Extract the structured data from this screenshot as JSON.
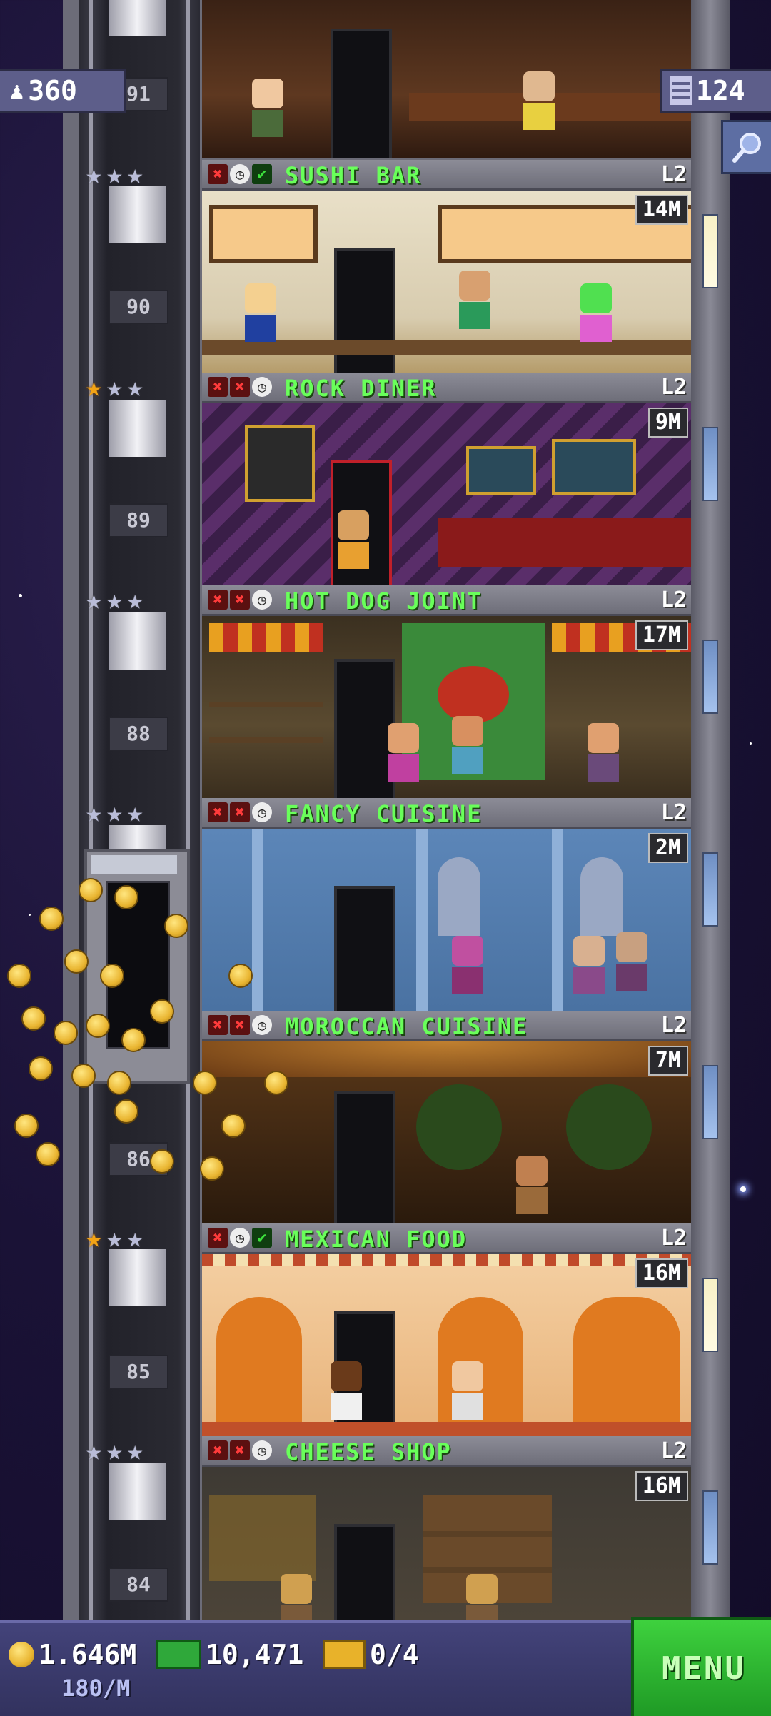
{
  "hud": {
    "population": "360",
    "floors_count": "124",
    "coins": "1.646M",
    "coin_rate": "180/M",
    "bux": "10,471",
    "tickets": "0/4",
    "menu_label": "MENU"
  },
  "icons": {
    "population": "person-icon",
    "floors": "building-icon",
    "search": "magnifier-icon",
    "coins": "coin-icon",
    "bux": "banknote-icon",
    "tickets": "ticket-icon"
  },
  "elevator": {
    "floor_numbers": [
      "91",
      "90",
      "89",
      "88",
      "86",
      "85",
      "84"
    ]
  },
  "floors": [
    {
      "name": "SUSHI BAR",
      "level": "L2",
      "badge": "14M",
      "stars_gold": 0,
      "status": [
        "x",
        "clock",
        "check"
      ]
    },
    {
      "name": "ROCK DINER",
      "level": "L2",
      "badge": "9M",
      "stars_gold": 1,
      "status": [
        "x",
        "x",
        "clock"
      ]
    },
    {
      "name": "HOT DOG JOINT",
      "level": "L2",
      "badge": "17M",
      "stars_gold": 0,
      "status": [
        "x",
        "x",
        "clock"
      ]
    },
    {
      "name": "FANCY CUISINE",
      "level": "L2",
      "badge": "2M",
      "stars_gold": 0,
      "status": [
        "x",
        "x",
        "clock"
      ]
    },
    {
      "name": "MOROCCAN CUISINE",
      "level": "L2",
      "badge": "7M",
      "stars_gold": 0,
      "status": [
        "x",
        "x",
        "clock"
      ]
    },
    {
      "name": "MEXICAN FOOD",
      "level": "L2",
      "badge": "16M",
      "stars_gold": 1,
      "status": [
        "x",
        "clock",
        "check"
      ]
    },
    {
      "name": "CHEESE SHOP",
      "level": "L2",
      "badge": "16M",
      "stars_gold": 0,
      "status": [
        "x",
        "x",
        "clock"
      ]
    }
  ],
  "colors": {
    "floor_name": "#69ff5a",
    "menu_button": "#2fb52f",
    "hud_panel": "#5d5e8a"
  }
}
